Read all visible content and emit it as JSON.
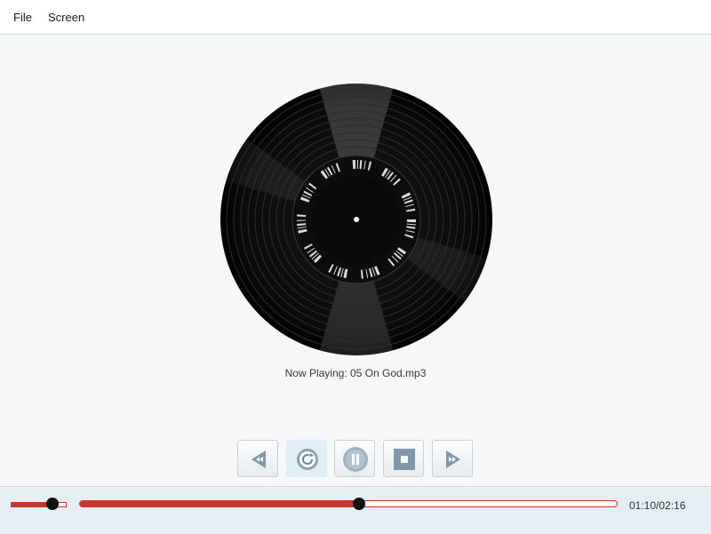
{
  "menu": {
    "items": [
      {
        "label": "File"
      },
      {
        "label": "Screen"
      }
    ]
  },
  "player": {
    "now_playing": "Now Playing: 05 On God.mp3",
    "time_display": "01:10/02:16",
    "seek_progress": 0.52,
    "volume_level": 0.75,
    "accent_color": "#c0392b"
  },
  "controls": {
    "buttons": [
      {
        "name": "rewind",
        "icon": "rewind-icon"
      },
      {
        "name": "repeat",
        "icon": "repeat-icon",
        "active": true
      },
      {
        "name": "pause",
        "icon": "pause-icon"
      },
      {
        "name": "stop",
        "icon": "stop-icon"
      },
      {
        "name": "fast-forward",
        "icon": "fast-forward-icon"
      }
    ]
  }
}
